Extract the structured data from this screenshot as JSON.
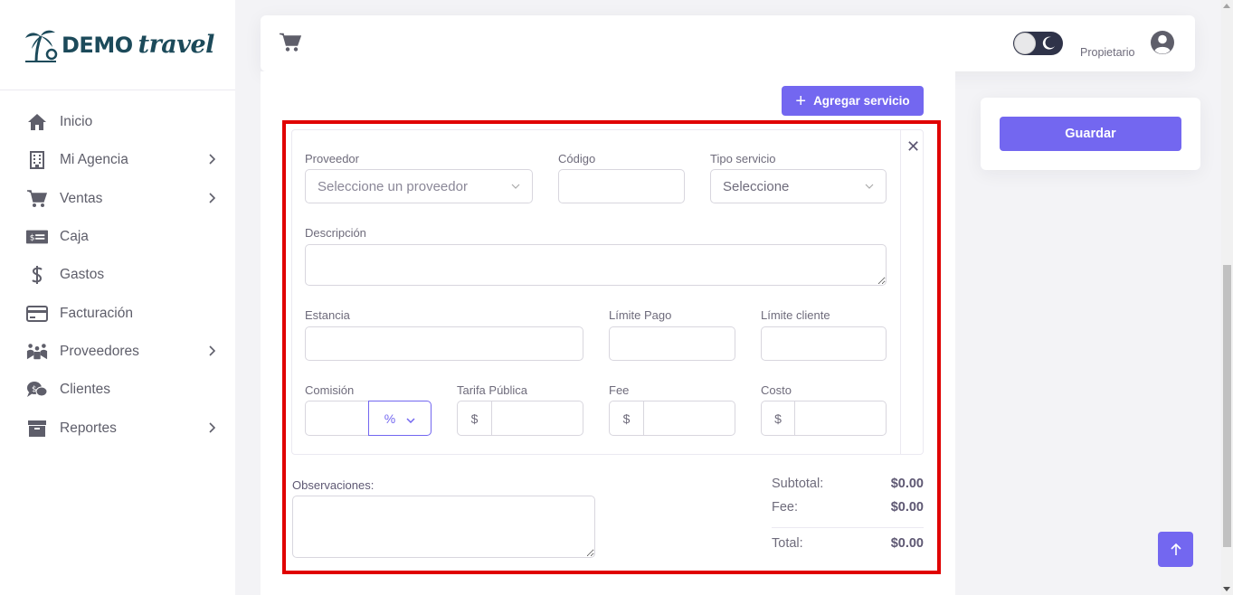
{
  "brand": {
    "logo_word1": "DEMO",
    "logo_word2": "travel",
    "color": "#1c4a5a"
  },
  "sidebar": {
    "items": [
      {
        "label": "Inicio",
        "icon": "home-icon",
        "has_children": false
      },
      {
        "label": "Mi Agencia",
        "icon": "building-icon",
        "has_children": true
      },
      {
        "label": "Ventas",
        "icon": "cart-icon",
        "has_children": true
      },
      {
        "label": "Caja",
        "icon": "cash-icon",
        "has_children": false
      },
      {
        "label": "Gastos",
        "icon": "dollar-icon",
        "has_children": false
      },
      {
        "label": "Facturación",
        "icon": "credit-card-icon",
        "has_children": false
      },
      {
        "label": "Proveedores",
        "icon": "people-icon",
        "has_children": true
      },
      {
        "label": "Clientes",
        "icon": "chat-dollar-icon",
        "has_children": false
      },
      {
        "label": "Reportes",
        "icon": "archive-icon",
        "has_children": true
      }
    ]
  },
  "header": {
    "user_name": "Propietario"
  },
  "actions": {
    "add_service": "Agregar servicio",
    "save": "Guardar"
  },
  "service": {
    "proveedor_label": "Proveedor",
    "proveedor_placeholder": "Seleccione un proveedor",
    "codigo_label": "Código",
    "tipo_label": "Tipo servicio",
    "tipo_value": "Seleccione",
    "descripcion_label": "Descripción",
    "estancia_label": "Estancia",
    "limite_pago_label": "Límite Pago",
    "limite_cliente_label": "Límite cliente",
    "comision_label": "Comisión",
    "comision_type": "%",
    "tarifa_label": "Tarifa Pública",
    "fee_label": "Fee",
    "costo_label": "Costo",
    "currency_symbol": "$"
  },
  "observaciones_label": "Observaciones:",
  "totals": {
    "subtotal_label": "Subtotal:",
    "subtotal_value": "$0.00",
    "fee_label": "Fee:",
    "fee_value": "$0.00",
    "total_label": "Total:",
    "total_value": "$0.00"
  },
  "colors": {
    "accent": "#7367f0",
    "highlight": "#e00000",
    "dark": "#2f3349"
  }
}
